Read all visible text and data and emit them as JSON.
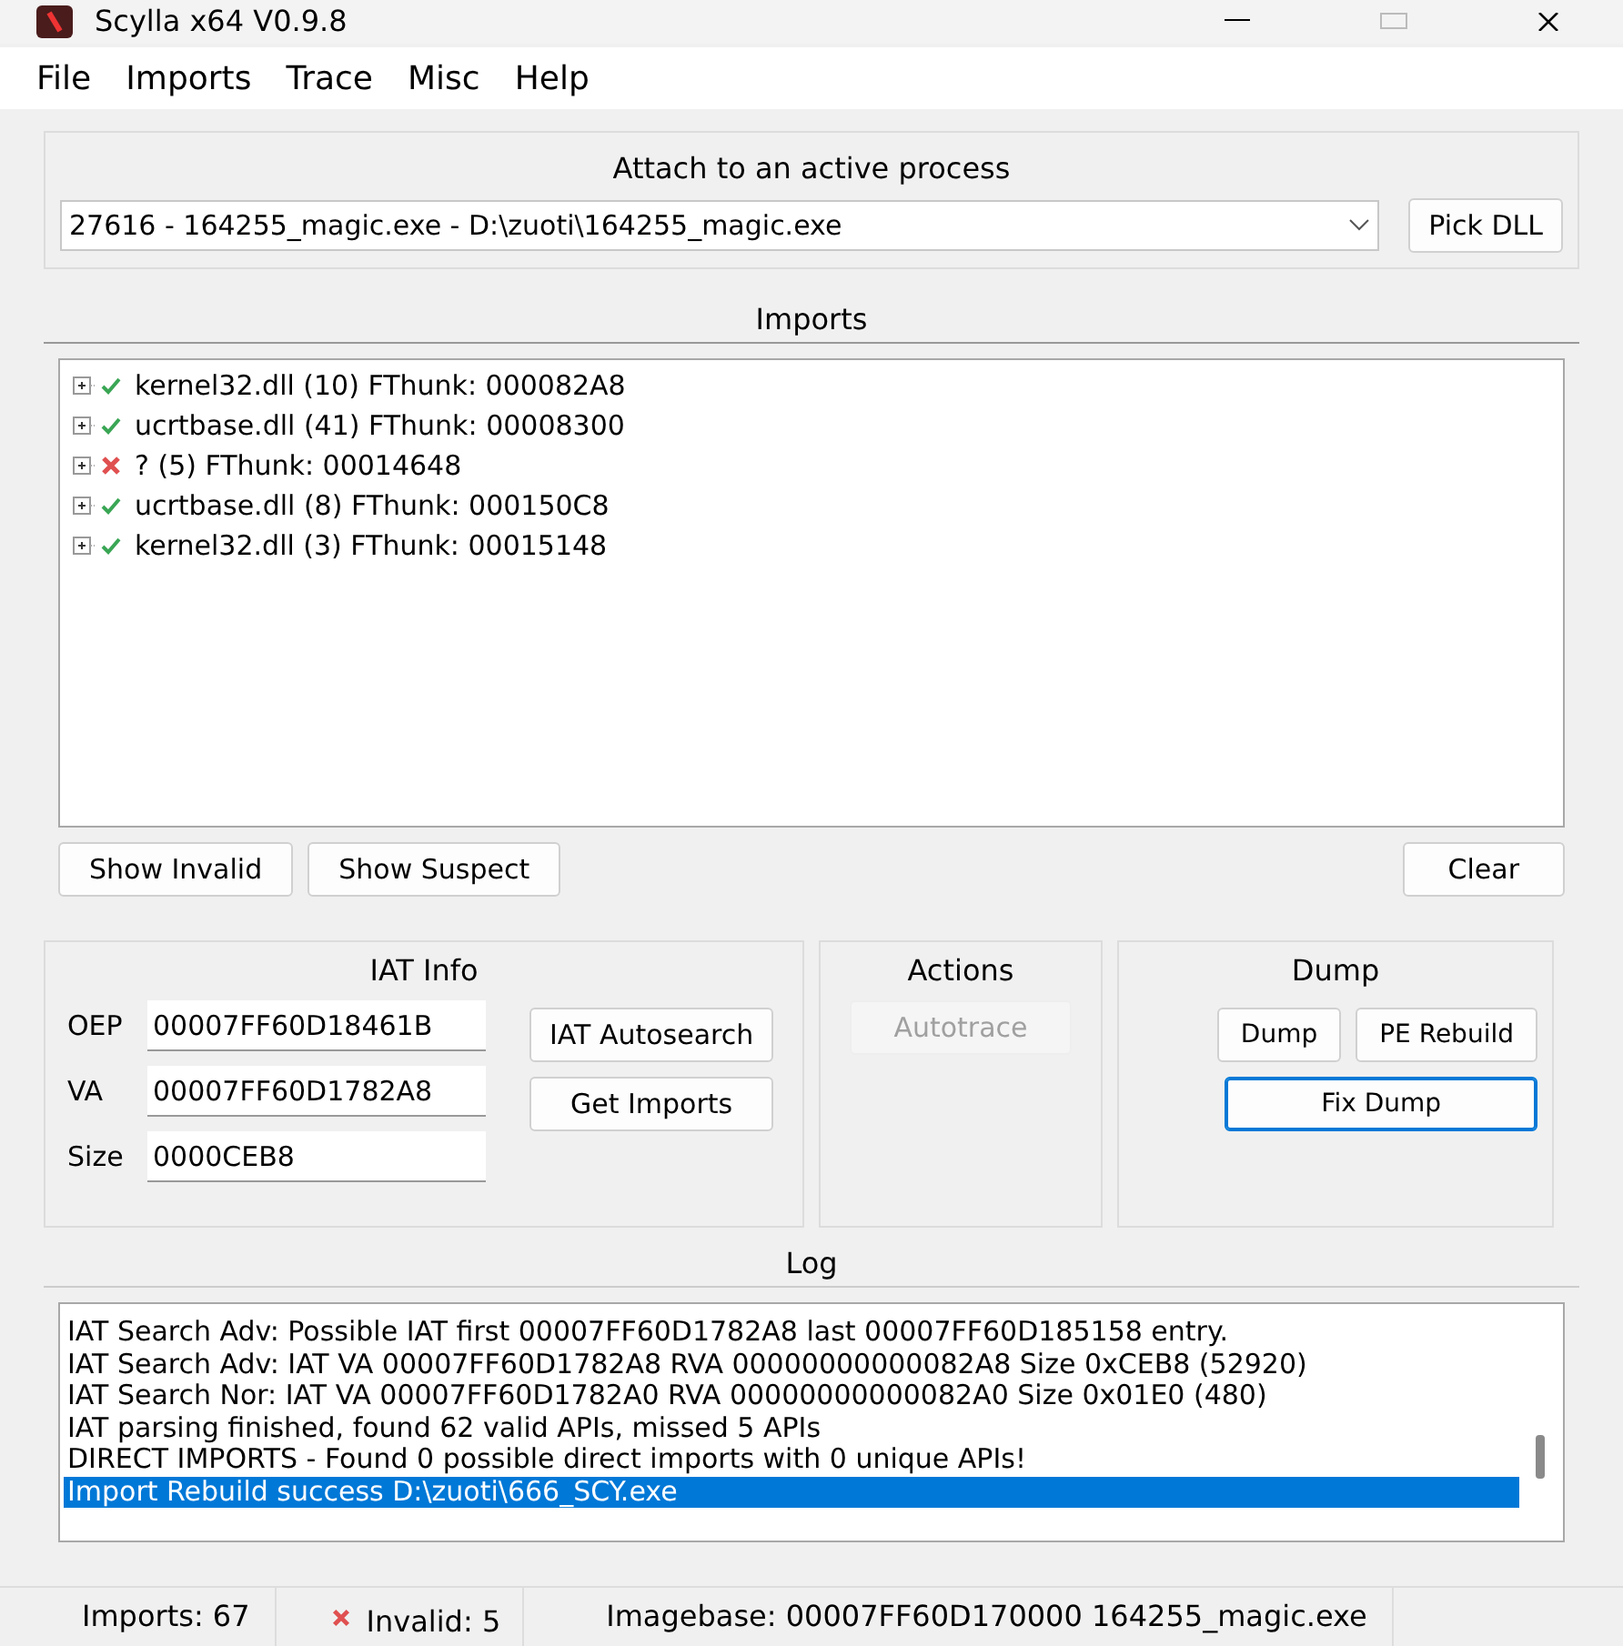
{
  "window": {
    "title": "Scylla x64 V0.9.8"
  },
  "menu": [
    "File",
    "Imports",
    "Trace",
    "Misc",
    "Help"
  ],
  "attach": {
    "title": "Attach to an active process",
    "process": "27616 - 164255_magic.exe - D:\\zuoti\\164255_magic.exe",
    "button": "Pick DLL"
  },
  "imports": {
    "title": "Imports",
    "items": [
      {
        "label": "kernel32.dll (10) FThunk: 000082A8",
        "valid": true
      },
      {
        "label": "ucrtbase.dll (41) FThunk: 00008300",
        "valid": true
      },
      {
        "label": "? (5) FThunk: 00014648",
        "valid": false
      },
      {
        "label": "ucrtbase.dll (8) FThunk: 000150C8",
        "valid": true
      },
      {
        "label": "kernel32.dll (3) FThunk: 00015148",
        "valid": true
      }
    ],
    "buttons": [
      "Show Invalid",
      "Show Suspect"
    ],
    "clear": "Clear"
  },
  "iat_info": {
    "title": "IAT Info",
    "fields": [
      {
        "label": "OEP",
        "value": "00007FF60D18461B"
      },
      {
        "label": "VA",
        "value": "00007FF60D1782A8"
      },
      {
        "label": "Size",
        "value": "0000CEB8"
      }
    ],
    "buttons": [
      "IAT Autosearch",
      "Get Imports"
    ]
  },
  "actions": {
    "title": "Actions",
    "buttons": [
      {
        "label": "Autotrace",
        "disabled": true
      }
    ]
  },
  "dump": {
    "title": "Dump",
    "buttons": [
      {
        "label": "Dump",
        "focused": false
      },
      {
        "label": "PE Rebuild",
        "focused": false
      },
      {
        "label": "Fix Dump",
        "focused": true
      }
    ]
  },
  "log": {
    "title": "Log",
    "lines": [
      {
        "text": "IAT Search Adv: Possible IAT first 00007FF60D1782A8 last 00007FF60D185158 entry.",
        "selected": false
      },
      {
        "text": "IAT Search Adv: IAT VA 00007FF60D1782A8 RVA 00000000000082A8 Size 0xCEB8 (52920)",
        "selected": false
      },
      {
        "text": "IAT Search Nor: IAT VA 00007FF60D1782A0 RVA 00000000000082A0 Size 0x01E0 (480)",
        "selected": false
      },
      {
        "text": "IAT parsing finished, found 62 valid APIs, missed 5 APIs",
        "selected": false
      },
      {
        "text": "DIRECT IMPORTS - Found 0 possible direct imports with 0 unique APIs!",
        "selected": false
      },
      {
        "text": "Import Rebuild success D:\\zuoti\\666_SCY.exe",
        "selected": true
      }
    ]
  },
  "status_bar": [
    {
      "kind": "plain",
      "text": "Imports: 67"
    },
    {
      "kind": "invalid",
      "text": "Invalid: 5"
    },
    {
      "kind": "plain",
      "text": "Imagebase: 00007FF60D170000 164255_magic.exe"
    }
  ]
}
